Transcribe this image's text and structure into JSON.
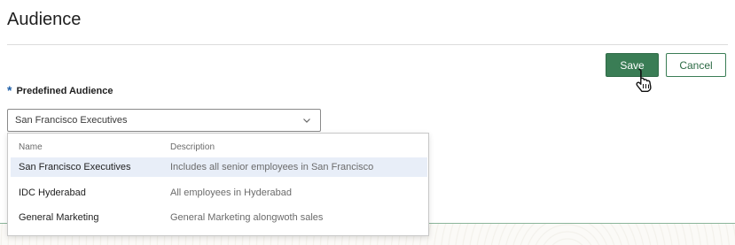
{
  "page": {
    "title": "Audience"
  },
  "actions": {
    "save_label": "Save",
    "cancel_label": "Cancel"
  },
  "field": {
    "required_mark": "*",
    "label": "Predefined Audience",
    "selected_value": "San Francisco Executives"
  },
  "dropdown": {
    "headers": {
      "name": "Name",
      "description": "Description"
    },
    "rows": [
      {
        "name": "San Francisco Executives",
        "description": "Includes all senior employees in San Francisco",
        "selected": true
      },
      {
        "name": "IDC Hyderabad",
        "description": "All employees in Hyderabad",
        "selected": false
      },
      {
        "name": "General Marketing",
        "description": "General Marketing alongwoth sales",
        "selected": false
      }
    ]
  },
  "colors": {
    "primary": "#3a7d55",
    "required": "#1f5fa8",
    "selected_row": "#e8eef8"
  },
  "icons": {
    "cursor": "hand-pointer-icon",
    "chevron": "chevron-down-icon"
  }
}
